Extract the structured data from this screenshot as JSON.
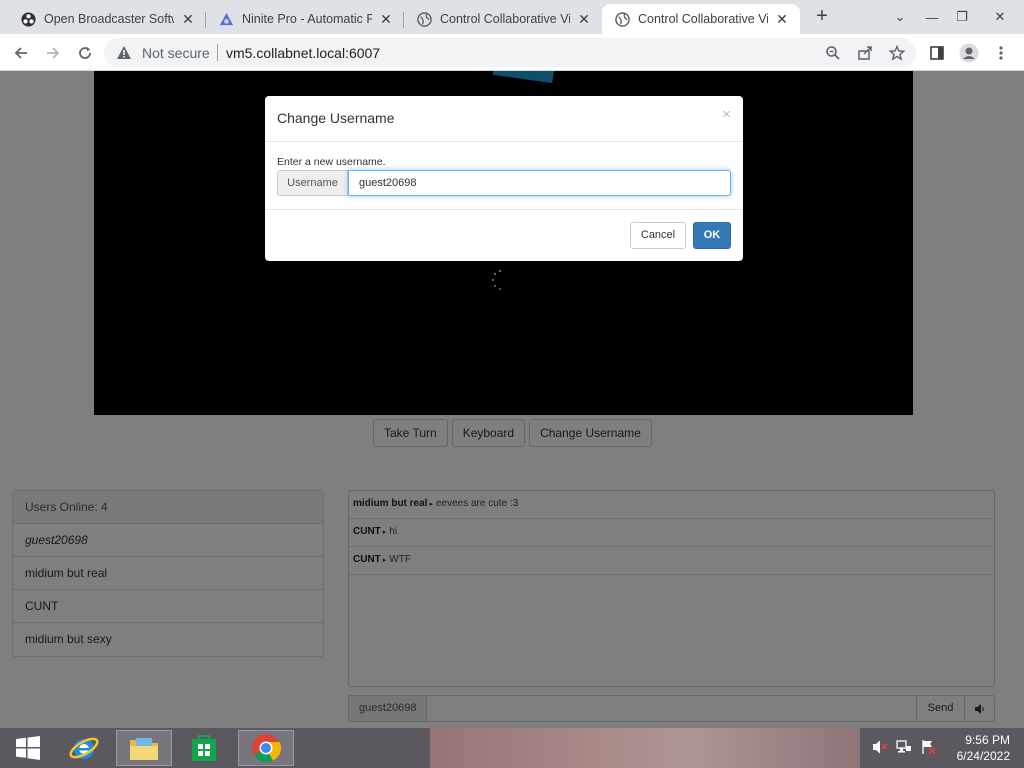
{
  "browser": {
    "tabs": [
      {
        "title": "Open Broadcaster Software",
        "icon": "obs-icon",
        "active": false
      },
      {
        "title": "Ninite Pro - Automatic Patching",
        "icon": "ninite-icon",
        "active": false
      },
      {
        "title": "Control Collaborative Virtual",
        "icon": "globe-icon",
        "active": false
      },
      {
        "title": "Control Collaborative Virtual",
        "icon": "globe-icon",
        "active": true
      }
    ],
    "security_label": "Not secure",
    "url": "vm5.collabnet.local:6007"
  },
  "vm": {
    "buttons": {
      "take_turn": "Take Turn",
      "keyboard": "Keyboard",
      "change_username": "Change Username"
    }
  },
  "users": {
    "header": "Users Online: 4",
    "list": [
      "guest20698",
      "midium but real",
      "CUNT",
      "midium but sexy"
    ]
  },
  "chat": {
    "messages": [
      {
        "user": "midium but real",
        "text": "eevees are cute :3"
      },
      {
        "user": "CUNT",
        "text": "hi"
      },
      {
        "user": "CUNT",
        "text": "WTF"
      }
    ],
    "input_name": "guest20698",
    "send_label": "Send"
  },
  "modal": {
    "title": "Change Username",
    "close_glyph": "×",
    "prompt": "Enter a new username.",
    "addon_label": "Username",
    "value": "guest20698",
    "cancel_label": "Cancel",
    "ok_label": "OK"
  },
  "taskbar": {
    "time": "9:56 PM",
    "date": "6/24/2022"
  }
}
